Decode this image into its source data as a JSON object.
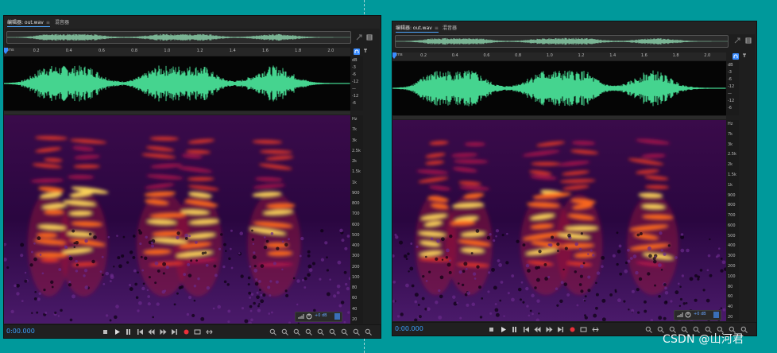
{
  "panels": [
    {
      "tabs": [
        {
          "label": "编辑器: out.wav",
          "close": "≡"
        },
        {
          "label": "混音器"
        }
      ],
      "ruler": {
        "unit": "hms",
        "ticks": [
          "0.2",
          "0.4",
          "0.6",
          "0.8",
          "1.0",
          "1.2",
          "1.4",
          "1.6",
          "1.8",
          "2.0"
        ]
      },
      "db_scale": [
        "dB",
        "-3",
        "-6",
        "-12",
        "—",
        "-12",
        "-6"
      ],
      "hz_scale": [
        "Hz",
        "7k",
        "3k",
        "2.5k",
        "2k",
        "1.5k",
        "1k",
        "900",
        "800",
        "700",
        "600",
        "500",
        "400",
        "300",
        "200",
        "100",
        "80",
        "60",
        "40",
        "20"
      ],
      "gain_readout": "+0 dB",
      "time_display": "0:00.000"
    },
    {
      "tabs": [
        {
          "label": "编辑器: out.wav",
          "close": "≡"
        },
        {
          "label": "混音器"
        }
      ],
      "ruler": {
        "unit": "hms",
        "ticks": [
          "0.2",
          "0.4",
          "0.6",
          "0.8",
          "1.0",
          "1.2",
          "1.4",
          "1.6",
          "1.8",
          "2.0"
        ]
      },
      "db_scale": [
        "dB",
        "-3",
        "-6",
        "-12",
        "—",
        "-12",
        "-6"
      ],
      "hz_scale": [
        "Hz",
        "7k",
        "3k",
        "2.5k",
        "2k",
        "1.5k",
        "1k",
        "900",
        "800",
        "700",
        "600",
        "500",
        "400",
        "300",
        "200",
        "100",
        "80",
        "60",
        "40",
        "20"
      ],
      "gain_readout": "+0 dB",
      "time_display": "0:00.000"
    }
  ],
  "transport_icons": [
    "stop-icon",
    "play-icon",
    "pause-icon",
    "go-to-start-icon",
    "rewind-icon",
    "fast-forward-icon",
    "go-to-end-icon",
    "record-icon",
    "loop-icon",
    "skip-selection-icon"
  ],
  "zoom_icons": [
    "zoom-in-amplitude-icon",
    "zoom-out-amplitude-icon",
    "zoom-in-time-icon",
    "zoom-out-time-icon",
    "zoom-out-full-icon",
    "zoom-in-at-start-icon",
    "zoom-in-at-end-icon",
    "zoom-selection-icon",
    "zoom-reset-icon"
  ],
  "colors": {
    "background": "#00999b",
    "waveform": "#45d48f",
    "time_display": "#3aa0ff"
  },
  "watermark": "CSDN @山河君"
}
